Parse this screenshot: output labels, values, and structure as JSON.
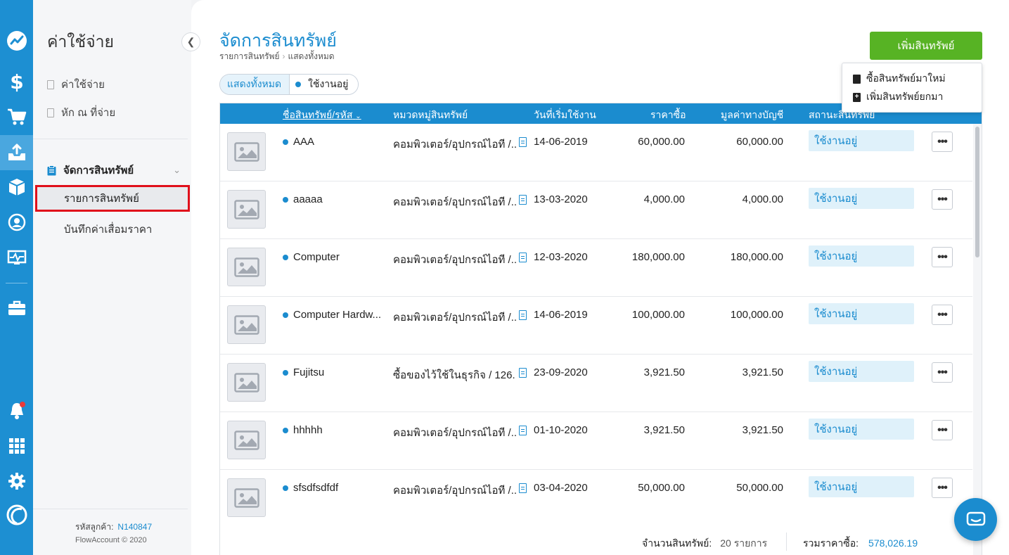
{
  "colors": {
    "brand": "#1b8ccf",
    "rail": "#1d8fd2",
    "add_button": "#57b324",
    "highlight": "#e0101b"
  },
  "rail": {
    "icons": [
      "trend-icon",
      "dollar-icon",
      "cart-icon",
      "tray-upload-icon",
      "box-icon",
      "contact-icon",
      "pulse-monitor-icon",
      "briefcase-icon",
      "bell-icon",
      "apps-grid-icon",
      "gear-icon",
      "flowaccount-logo-icon"
    ],
    "active": "tray-upload-icon"
  },
  "sidebar": {
    "title": "ค่าใช้จ่าย",
    "links": [
      "ค่าใช้จ่าย",
      "หัก ณ ที่จ่าย"
    ],
    "group_label": "จัดการสินทรัพย์",
    "items": [
      "รายการสินทรัพย์",
      "บันทึกค่าเสื่อมราคา"
    ],
    "customer_label": "รหัสลูกค้า:",
    "customer_id": "N140847",
    "copyright": "FlowAccount © 2020"
  },
  "header": {
    "title": "จัดการสินทรัพย์",
    "breadcrumb": [
      "รายการสินทรัพย์",
      "แสดงทั้งหมด"
    ],
    "add_button": "เพิ่มสินทรัพย์",
    "dropdown": [
      "ซื้อสินทรัพย์มาใหม่",
      "เพิ่มสินทรัพย์ยกมา"
    ]
  },
  "filters": {
    "all": "แสดงทั้งหมด",
    "active": "ใช้งานอยู่"
  },
  "table": {
    "columns": [
      "ชื่อสินทรัพย์/รหัส",
      "หมวดหมู่สินทรัพย์",
      "วันที่เริ่มใช้งาน",
      "ราคาซื้อ",
      "มูลค่าทางบัญชี",
      "สถานะสินทรัพย์"
    ],
    "rows": [
      {
        "name": "AAA",
        "category": "คอมพิวเตอร์/อุปกรณ์ไอที /...",
        "date": "14-06-2019",
        "price": "60,000.00",
        "book_value": "60,000.00",
        "status": "ใช้งานอยู่"
      },
      {
        "name": "aaaaa",
        "category": "คอมพิวเตอร์/อุปกรณ์ไอที /...",
        "date": "13-03-2020",
        "price": "4,000.00",
        "book_value": "4,000.00",
        "status": "ใช้งานอยู่"
      },
      {
        "name": "Computer",
        "category": "คอมพิวเตอร์/อุปกรณ์ไอที /...",
        "date": "12-03-2020",
        "price": "180,000.00",
        "book_value": "180,000.00",
        "status": "ใช้งานอยู่"
      },
      {
        "name": "Computer Hardw...",
        "category": "คอมพิวเตอร์/อุปกรณ์ไอที /...",
        "date": "14-06-2019",
        "price": "100,000.00",
        "book_value": "100,000.00",
        "status": "ใช้งานอยู่"
      },
      {
        "name": "Fujitsu",
        "category": "ซื้อของไว้ใช้ในธุรกิจ / 126...",
        "date": "23-09-2020",
        "price": "3,921.50",
        "book_value": "3,921.50",
        "status": "ใช้งานอยู่"
      },
      {
        "name": "hhhhh",
        "category": "คอมพิวเตอร์/อุปกรณ์ไอที /...",
        "date": "01-10-2020",
        "price": "3,921.50",
        "book_value": "3,921.50",
        "status": "ใช้งานอยู่"
      },
      {
        "name": "sfsdfsdfdf",
        "category": "คอมพิวเตอร์/อุปกรณ์ไอที /...",
        "date": "03-04-2020",
        "price": "50,000.00",
        "book_value": "50,000.00",
        "status": "ใช้งานอยู่"
      }
    ]
  },
  "footer": {
    "count_label": "จำนวนสินทรัพย์:",
    "count_value": "20 รายการ",
    "total_label": "รวมราคาซื้อ:",
    "total_value": "578,026.19"
  }
}
